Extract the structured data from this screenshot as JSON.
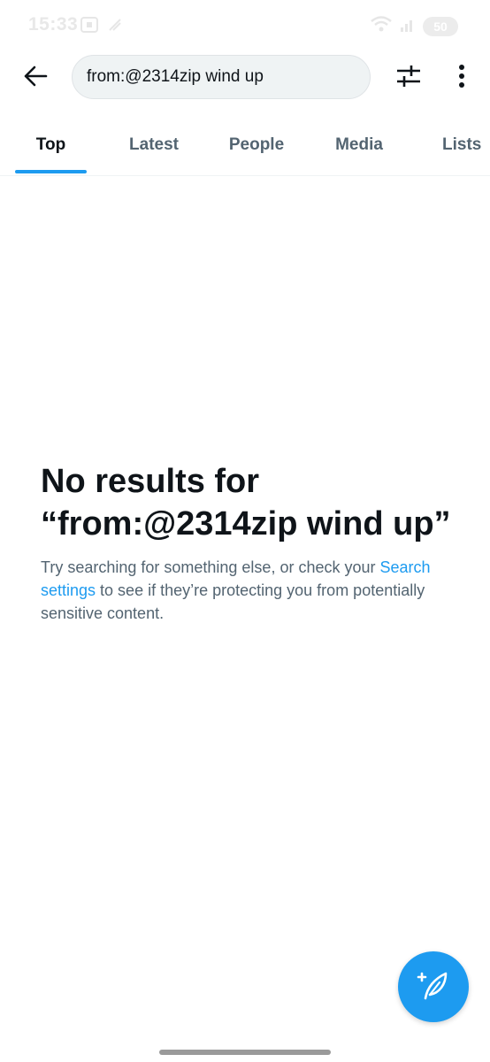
{
  "status_bar": {
    "time": "15:33",
    "battery": "50"
  },
  "header": {
    "search_value": "from:@2314zip wind up"
  },
  "tabs": [
    {
      "label": "Top",
      "active": true
    },
    {
      "label": "Latest",
      "active": false
    },
    {
      "label": "People",
      "active": false
    },
    {
      "label": "Media",
      "active": false
    },
    {
      "label": "Lists",
      "active": false
    }
  ],
  "empty_state": {
    "title": "No results for “from:@2314zip wind up”",
    "desc_before": "Try searching for something else, or check your ",
    "link": "Search settings",
    "desc_after": " to see if they’re protecting you from potentially sensitive content."
  },
  "colors": {
    "accent": "#1d9bf0",
    "text_primary": "#0f1419",
    "text_secondary": "#536471"
  },
  "icons": {
    "back": "arrow-left-icon",
    "filter": "sliders-icon",
    "more": "more-vertical-icon",
    "compose": "feather-plus-icon"
  }
}
